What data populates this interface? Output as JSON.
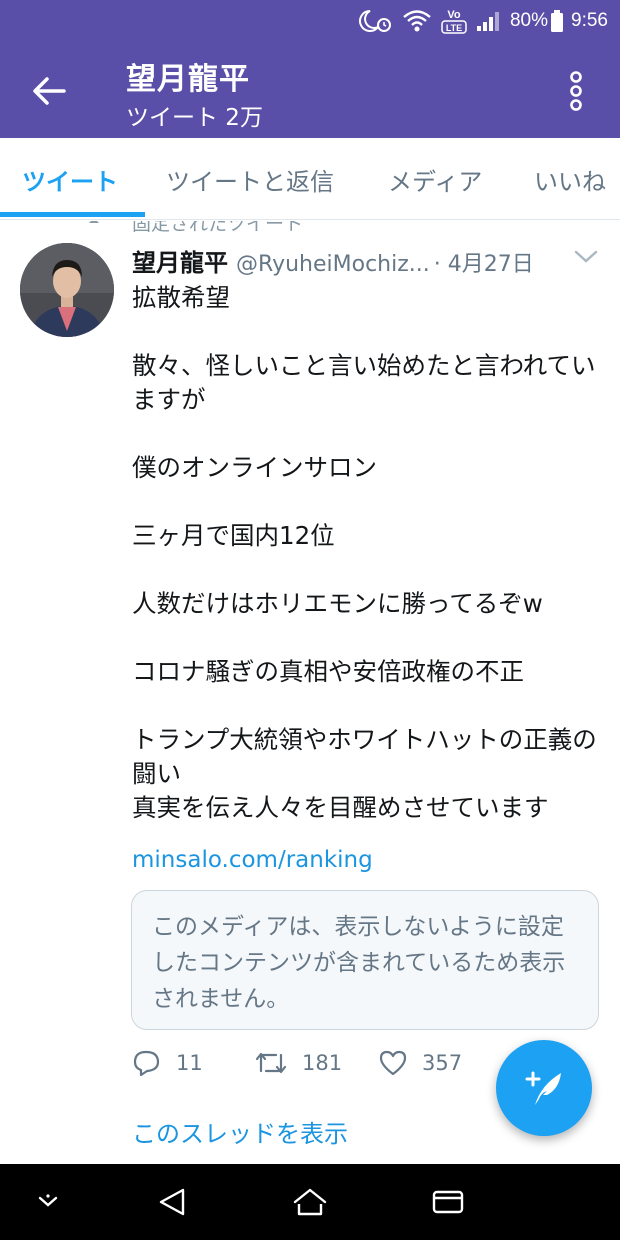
{
  "status_bar": {
    "battery": "80%",
    "time": "9:56",
    "volte_label_top": "Vo",
    "volte_label_bottom": "LTE",
    "icons": [
      "moon-alarm-icon",
      "wifi-icon",
      "volte-icon",
      "signal-icon",
      "battery-icon"
    ]
  },
  "header": {
    "title": "望月龍平",
    "subtitle": "ツイート 2万",
    "back_icon": "arrow-left-icon",
    "more_icon": "more-vertical-icon"
  },
  "tabs": [
    {
      "label": "ツイート",
      "active": true
    },
    {
      "label": "ツイートと返信",
      "active": false
    },
    {
      "label": "メディア",
      "active": false
    },
    {
      "label": "いいね",
      "active": false
    }
  ],
  "tweet": {
    "pinned_label": "固定されたツイート",
    "author_name": "望月龍平",
    "author_handle": "@RyuheiMochiz...",
    "date": "· 4月27日",
    "lines": [
      "拡散希望",
      "",
      "散々、怪しいこと言い始めたと言われていますが",
      "",
      "僕のオンラインサロン",
      "",
      "三ヶ月で国内12位",
      "",
      "人数だけはホリエモンに勝ってるぞw",
      "",
      "コロナ騒ぎの真相や安倍政権の不正",
      "",
      "トランプ大統領やホワイトハットの正義の闘い",
      "真実を伝え人々を目醒めさせています"
    ],
    "link": "minsalo.com/ranking",
    "media_warning": "このメディアは、表示しないように設定したコンテンツが含まれているため表示されません。",
    "replies": "11",
    "retweets": "181",
    "likes": "357",
    "thread_link": "このスレッドを表示"
  },
  "colors": {
    "header_bg": "#5a4fa8",
    "accent": "#1da1f2",
    "link": "#1b95e0",
    "muted": "#657786"
  },
  "nav_bar": {
    "icons": [
      "chevron-down-icon",
      "back-triangle-icon",
      "home-icon",
      "recents-icon"
    ]
  }
}
